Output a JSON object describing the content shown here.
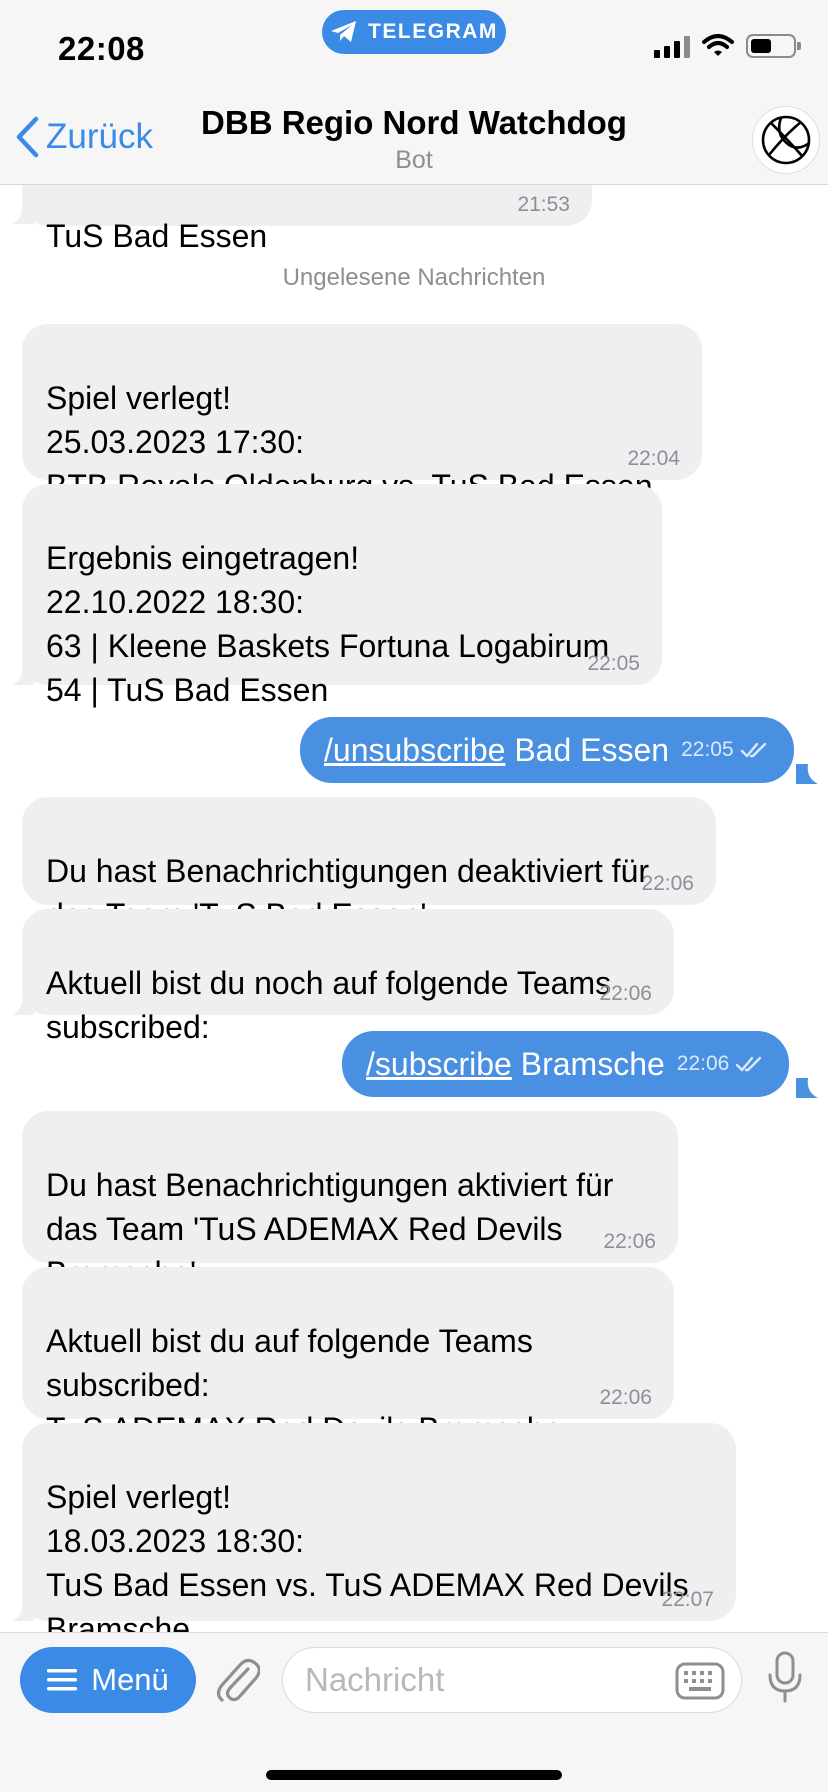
{
  "status": {
    "time": "22:08",
    "app_pill": "TELEGRAM"
  },
  "header": {
    "back_label": "Zurück",
    "title": "DBB Regio Nord Watchdog",
    "subtitle": "Bot",
    "avatar_icon": "basketball-icon"
  },
  "messages": {
    "prev": {
      "text": "TuS Bad Essen",
      "time": "21:53"
    },
    "unread_label": "Ungelesene Nachrichten",
    "m1": {
      "text": "Spiel verlegt!\n25.03.2023  17:30:\nBTB Royals Oldenburg  vs. TuS Bad Essen",
      "time": "22:04"
    },
    "m2": {
      "text": "Ergebnis eingetragen!\n22.10.2022  18:30:\n63 | Kleene Baskets Fortuna Logabirum\n54 | TuS Bad Essen",
      "time": "22:05"
    },
    "out1": {
      "command": "/unsubscribe",
      "arg": " Bad Essen",
      "time": "22:05"
    },
    "m3": {
      "text": "Du hast Benachrichtigungen deaktiviert für\ndas Team 'TuS Bad Essen'",
      "time": "22:06"
    },
    "m4": {
      "text": "Aktuell bist du noch auf folgende Teams\nsubscribed:",
      "time": "22:06"
    },
    "out2": {
      "command": "/subscribe",
      "arg": " Bramsche",
      "time": "22:06"
    },
    "m5": {
      "text": "Du hast Benachrichtigungen aktiviert für\ndas Team 'TuS ADEMAX Red Devils\nBramsche'",
      "time": "22:06"
    },
    "m6": {
      "text": "Aktuell bist du auf folgende Teams\nsubscribed:\nTuS ADEMAX Red Devils Bramsche",
      "time": "22:06"
    },
    "m7": {
      "text": "Spiel verlegt!\n18.03.2023  18:30:\nTuS Bad Essen  vs. TuS ADEMAX Red Devils\nBramsche",
      "time": "22:07"
    }
  },
  "input": {
    "menu_label": "Menü",
    "placeholder": "Nachricht"
  },
  "colors": {
    "accent": "#3a8ae6",
    "outgoing_bubble": "#4a90e2",
    "incoming_bubble": "#efeff2"
  }
}
